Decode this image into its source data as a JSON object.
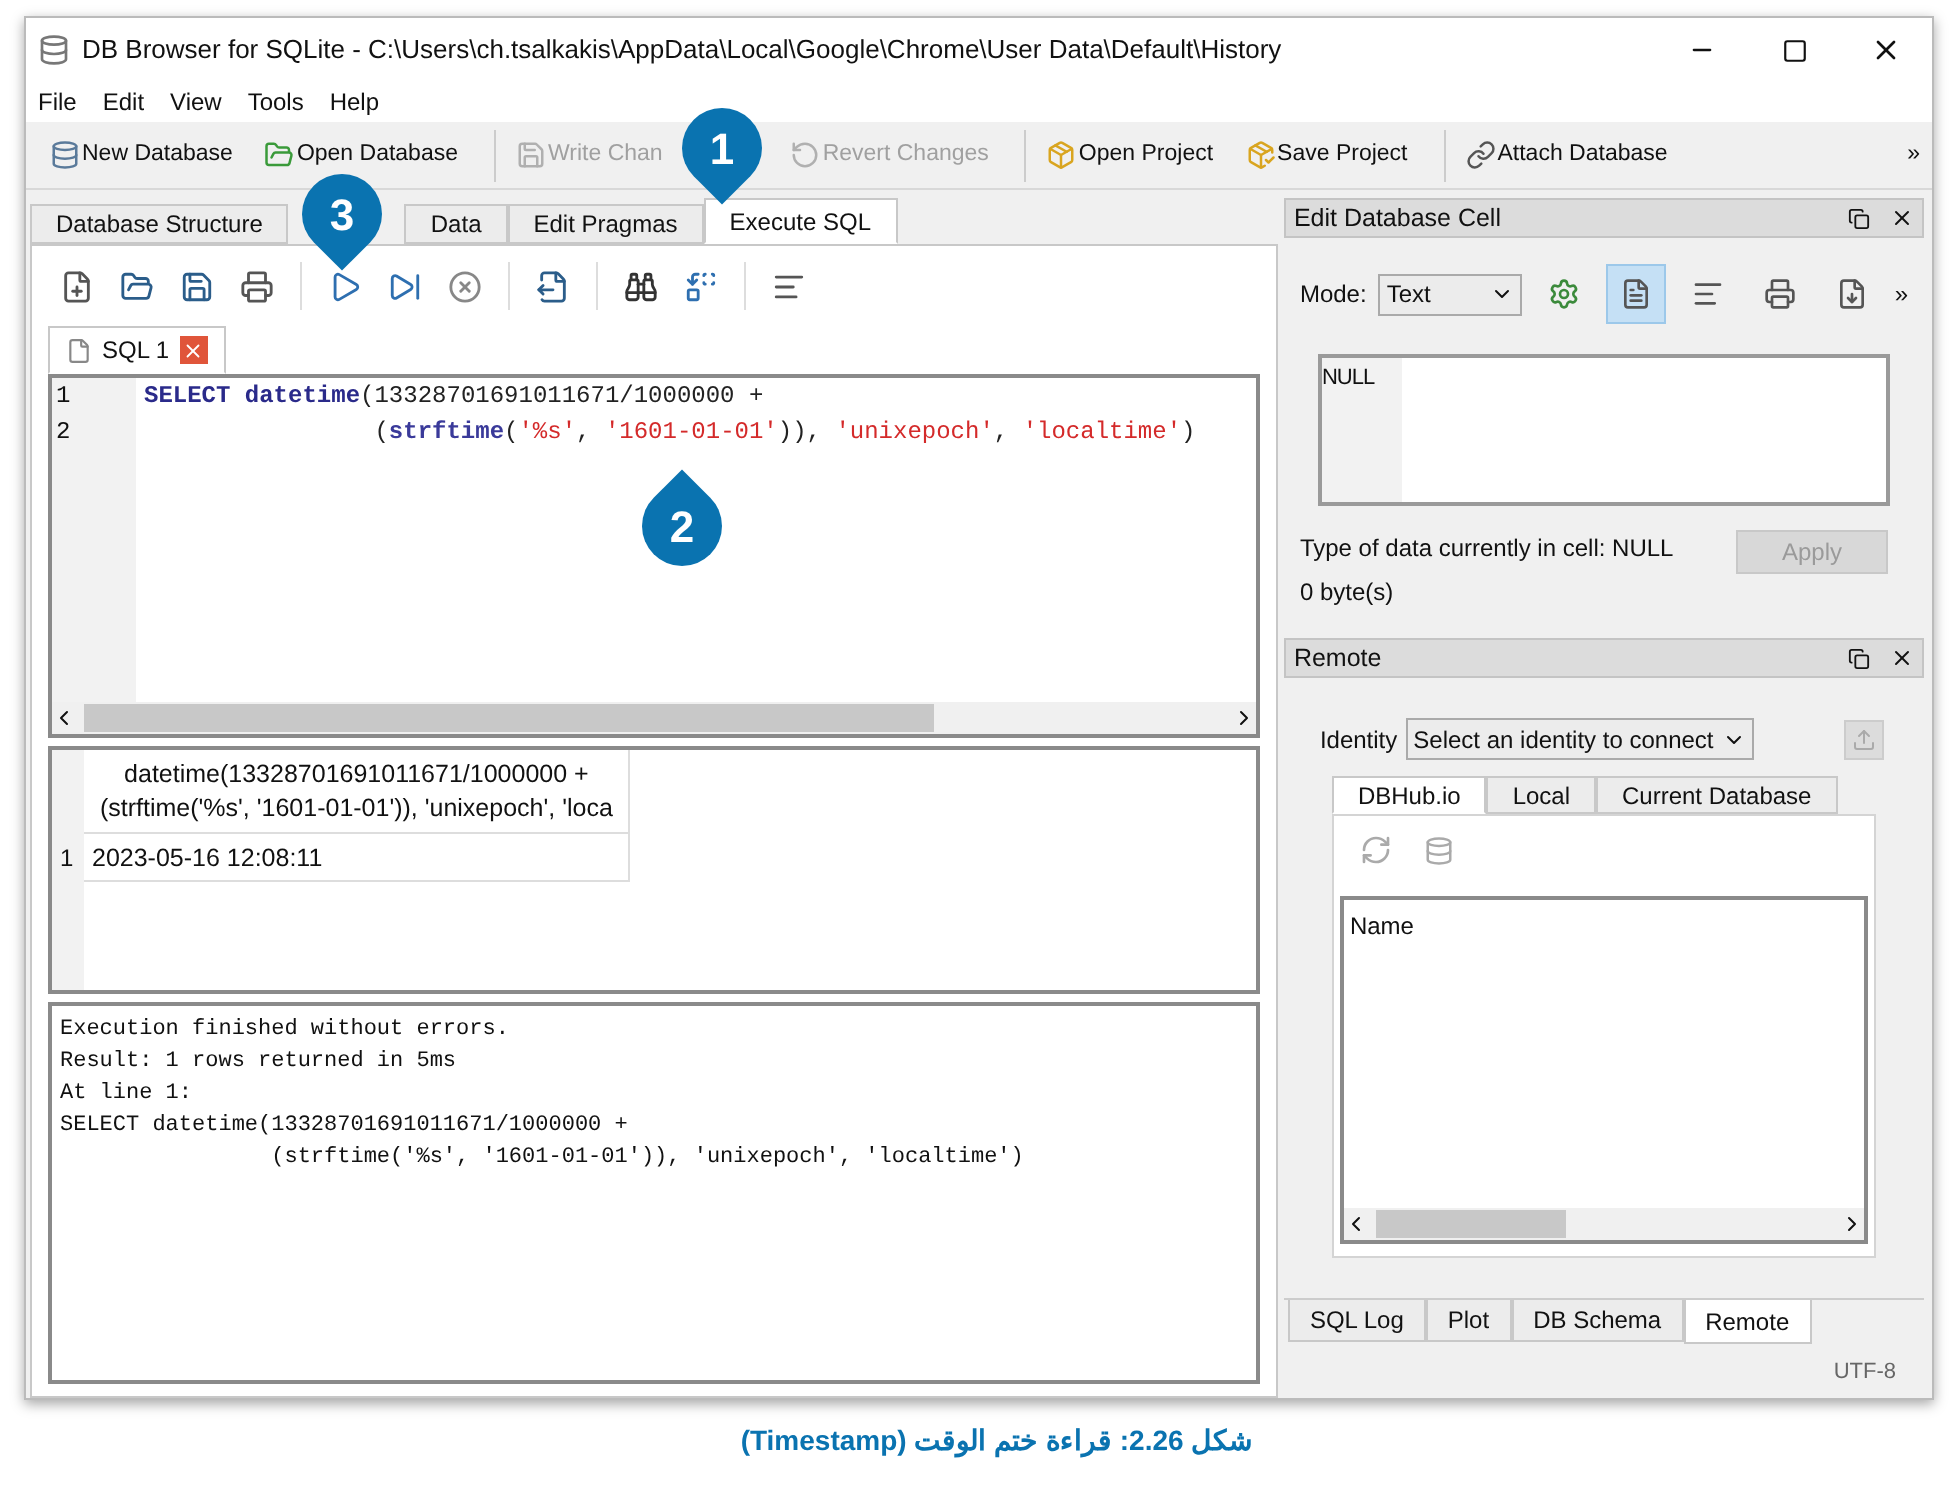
{
  "window": {
    "title": "DB Browser for SQLite - C:\\Users\\ch.tsalkakis\\AppData\\Local\\Google\\Chrome\\User Data\\Default\\History"
  },
  "menu": [
    "File",
    "Edit",
    "View",
    "Tools",
    "Help"
  ],
  "toolbar": [
    {
      "label": "New Database",
      "disabled": false
    },
    {
      "label": "Open Database",
      "disabled": false
    },
    {
      "label": "Write Chan",
      "disabled": true
    },
    {
      "label": "Revert Changes",
      "disabled": true
    },
    {
      "label": "Open Project",
      "disabled": false
    },
    {
      "label": "Save Project",
      "disabled": false
    },
    {
      "label": "Attach Database",
      "disabled": false
    }
  ],
  "toolbar_more": "»",
  "main_tabs": [
    {
      "label": "Database Structure",
      "selected": false
    },
    {
      "label": "Data",
      "selected": false
    },
    {
      "label": "Edit Pragmas",
      "selected": false
    },
    {
      "label": "Execute SQL",
      "selected": true
    }
  ],
  "sql_tabs": [
    {
      "label": "SQL 1",
      "selected": true
    }
  ],
  "editor": {
    "lines": [
      {
        "number": "1",
        "tokens": [
          {
            "text": "SELECT datetime",
            "kind": "keyword"
          },
          {
            "text": "(13328701691011671/1000000 +",
            "kind": "plain"
          }
        ]
      },
      {
        "number": "2",
        "tokens": [
          {
            "text": "                (",
            "kind": "plain"
          },
          {
            "text": "strftime",
            "kind": "function"
          },
          {
            "text": "(",
            "kind": "plain"
          },
          {
            "text": "'%s'",
            "kind": "string"
          },
          {
            "text": ", ",
            "kind": "plain"
          },
          {
            "text": "'1601-01-01'",
            "kind": "string"
          },
          {
            "text": ")), ",
            "kind": "plain"
          },
          {
            "text": "'unixepoch'",
            "kind": "string"
          },
          {
            "text": ", ",
            "kind": "plain"
          },
          {
            "text": "'localtime'",
            "kind": "string"
          },
          {
            "text": ")",
            "kind": "plain"
          }
        ]
      }
    ]
  },
  "results": {
    "header": [
      "datetime(13328701691011671/1000000 +",
      "(strftime('%s', '1601-01-01')), 'unixepoch', 'loca"
    ],
    "rows": [
      {
        "number": "1",
        "value": "2023-05-16 12:08:11"
      }
    ]
  },
  "log": [
    "Execution finished without errors.",
    "Result: 1 rows returned in 5ms",
    "At line 1:",
    "SELECT datetime(13328701691011671/1000000 +",
    "                (strftime('%s', '1601-01-01')), 'unixepoch', 'localtime')"
  ],
  "edit_cell": {
    "title": "Edit Database Cell",
    "mode_label": "Mode:",
    "mode_value": "Text",
    "tools": [
      {
        "selected": false
      },
      {
        "selected": true
      },
      {
        "selected": false
      },
      {
        "selected": false
      },
      {
        "selected": false
      }
    ],
    "more": "»",
    "cell_value": "NULL",
    "type_info": "Type of data currently in cell: NULL",
    "size_info": "0 byte(s)",
    "apply": {
      "label": "Apply",
      "disabled": true
    }
  },
  "remote": {
    "title": "Remote",
    "identity_label": "Identity",
    "identity_placeholder": "Select an identity to connect",
    "tabs": [
      {
        "label": "DBHub.io",
        "selected": true
      },
      {
        "label": "Local",
        "selected": false
      },
      {
        "label": "Current Database",
        "selected": false
      }
    ],
    "list_header": "Name"
  },
  "dock_tabs": [
    {
      "label": "SQL Log",
      "selected": false
    },
    {
      "label": "Plot",
      "selected": false
    },
    {
      "label": "DB Schema",
      "selected": false
    },
    {
      "label": "Remote",
      "selected": true
    }
  ],
  "status_bar": {
    "encoding": "UTF-8"
  },
  "callouts": [
    "1",
    "2",
    "3"
  ],
  "caption": "شكل 2.26: قراءة ختم الوقت (Timestamp)"
}
